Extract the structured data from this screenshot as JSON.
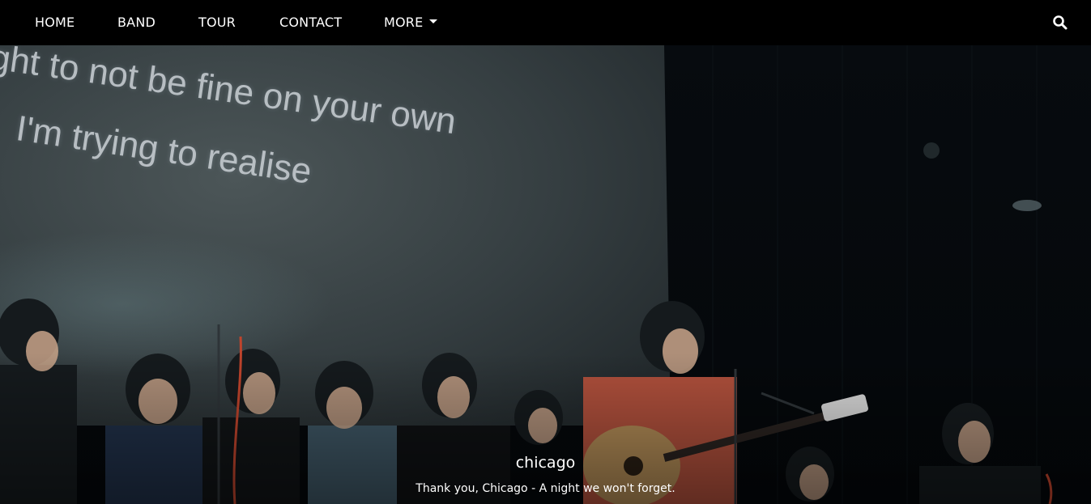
{
  "nav": {
    "items": [
      "HOME",
      "BAND",
      "TOUR",
      "CONTACT"
    ],
    "more_label": "MORE"
  },
  "hero": {
    "lyrics": [
      "ght to not be fine on your own",
      "I'm trying to realise"
    ],
    "caption_title": "chicago",
    "caption_text": "Thank you, Chicago - A night we won't forget."
  },
  "icons": {
    "search": "search-icon",
    "more": "caret-down-icon"
  },
  "colors": {
    "navbar_bg": "#000000",
    "nav_text": "#ffffff",
    "screen": "#3a4346",
    "stage": "#05080b"
  }
}
